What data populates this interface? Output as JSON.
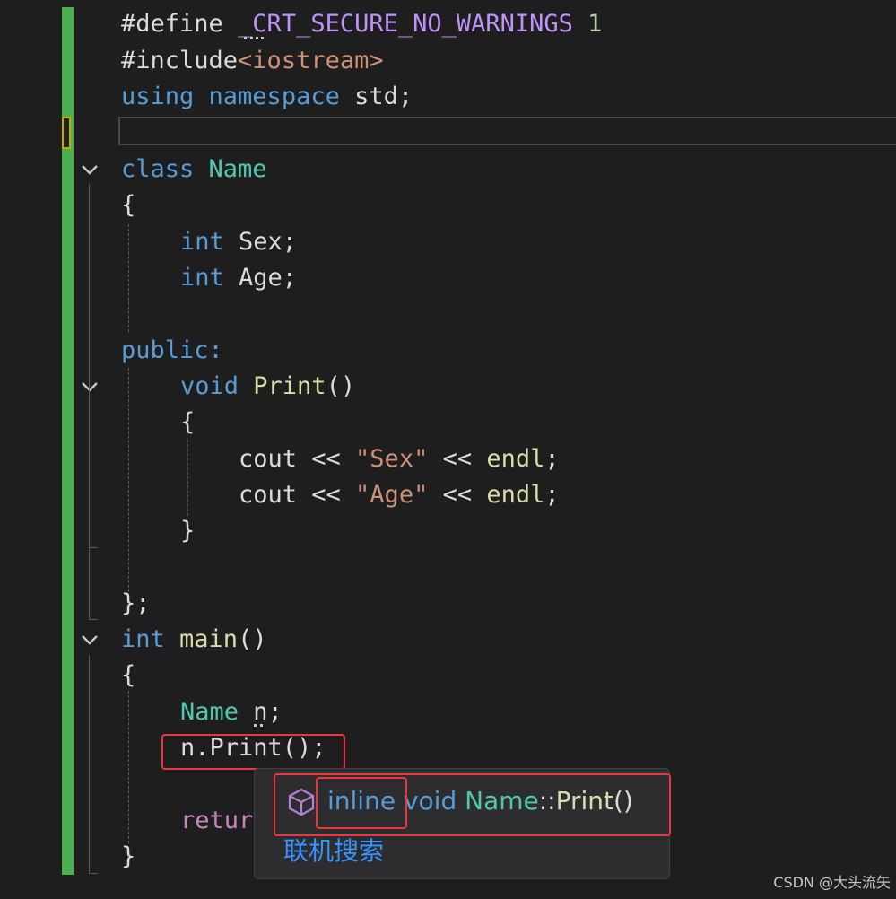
{
  "editor": {
    "lines": {
      "l1": {
        "a": "#define ",
        "b": "_CRT_SECURE_NO_WARNINGS",
        "c": " 1"
      },
      "l2": {
        "a": "#include",
        "b": "<iostream>"
      },
      "l3": {
        "a": "using",
        "b": " namespace ",
        "c": "std;"
      },
      "l5": {
        "a": "class",
        "b": " Name"
      },
      "l6": {
        "a": "{"
      },
      "l7": {
        "a": "int",
        "b": " Sex;"
      },
      "l8": {
        "a": "int",
        "b": " Age;"
      },
      "l10": {
        "a": "public:"
      },
      "l11": {
        "a": "void",
        "b": " Print",
        "c": "()"
      },
      "l12": {
        "a": "{"
      },
      "l13": {
        "a": "cout << ",
        "b": "\"Sex\"",
        "c": " << ",
        "d": "endl",
        "e": ";"
      },
      "l14": {
        "a": "cout << ",
        "b": "\"Age\"",
        "c": " << ",
        "d": "endl",
        "e": ";"
      },
      "l15": {
        "a": "}"
      },
      "l17": {
        "a": "};"
      },
      "l18": {
        "a": "int",
        "b": " main",
        "c": "()"
      },
      "l19": {
        "a": "{"
      },
      "l20": {
        "a": "Name",
        "b": " n;"
      },
      "l21": {
        "a": "n.Print();"
      },
      "l23": {
        "a": "retur"
      },
      "l24": {
        "a": "}"
      }
    }
  },
  "tooltip": {
    "signature": {
      "inline": "inline",
      "void": " void ",
      "cls": "Name",
      "sep": "::",
      "fn": "Print",
      "paren": "()"
    },
    "search_link": "联机搜索"
  },
  "watermark": "CSDN @大头流矢",
  "colors": {
    "keyword": "#569cd6",
    "type": "#4ec9b0",
    "function": "#dcdcaa",
    "string": "#ce9178",
    "preprocessor": "#c586c0",
    "highlight_box": "#e8383d",
    "change_bar": "#4caf50"
  }
}
